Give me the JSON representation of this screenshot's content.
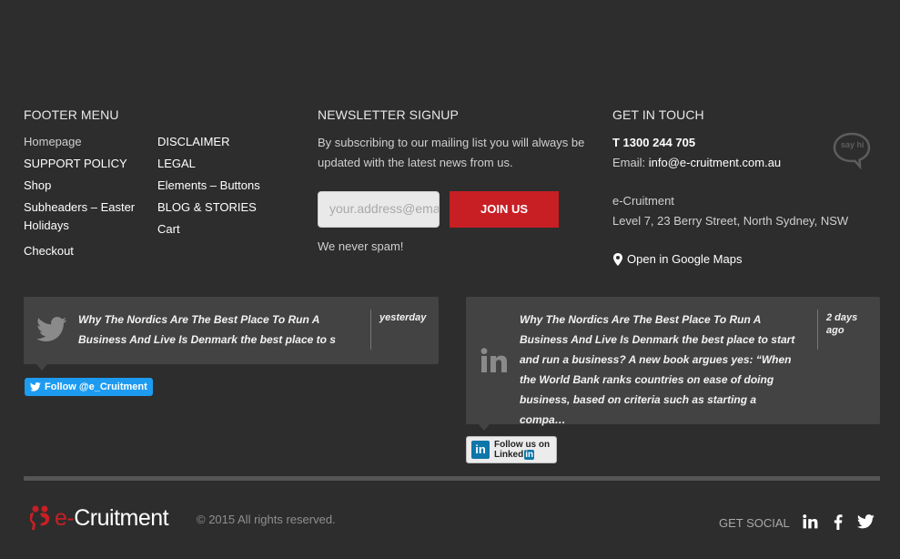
{
  "footer_menu": {
    "heading": "FOOTER MENU",
    "col1": [
      "Homepage",
      "SUPPORT POLICY",
      "Shop",
      "Subheaders – Easter Holidays",
      "Checkout"
    ],
    "col2": [
      "DISCLAIMER",
      "LEGAL",
      "Elements – Buttons",
      "BLOG & STORIES",
      "Cart"
    ]
  },
  "newsletter": {
    "heading": "NEWSLETTER SIGNUP",
    "text": "By subscribing to our mailing list you will always be updated with the latest news from us.",
    "placeholder": "your.address@email.com",
    "button": "JOIN US",
    "note": "We never spam!"
  },
  "contact": {
    "heading": "GET IN TOUCH",
    "phone": "T 1300 244 705",
    "email_label": "Email: ",
    "email": "info@e-cruitment.com.au",
    "company": "e-Cruitment",
    "address": "Level 7, 23 Berry Street, North Sydney, NSW",
    "maps_link": "Open in Google Maps",
    "say_hi": "say hi"
  },
  "twitter": {
    "text": "Why The Nordics Are The Best Place To Run A Business And Live Is Denmark the best place to s",
    "time": "yesterday",
    "follow": "Follow @e_Cruitment",
    "brand_color": "#1d9bf0"
  },
  "linkedin": {
    "text": "Why The Nordics Are The Best Place To Run A Business And Live Is Denmark the best place to start and run a business? A new book argues yes: “When the World Bank ranks countries on ease of doing business, based on criteria such as starting a compa…",
    "time": "2 days ago",
    "follow_line1": "Follow us on",
    "follow_line2": "Linked",
    "follow_in": "in"
  },
  "bottom": {
    "logo_text": "e-Cruitment",
    "copyright": "© 2015 All rights reserved.",
    "get_social": "GET SOCIAL",
    "accent": "#c81f25"
  }
}
